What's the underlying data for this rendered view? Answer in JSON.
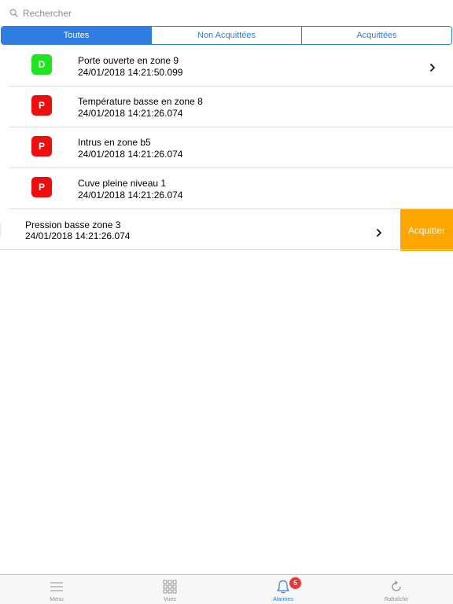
{
  "search": {
    "placeholder": "Rechercher"
  },
  "segments": [
    {
      "label": "Toutes"
    },
    {
      "label": "Non Acquittées"
    },
    {
      "label": "Acquittées"
    }
  ],
  "alarms": [
    {
      "badge": "D",
      "color": "#1ee51e",
      "title": "Porte ouverte en zone 9",
      "date": "24/01/2018 14:21:50.099"
    },
    {
      "badge": "P",
      "color": "#f20d0d",
      "title": "Température basse en zone 8",
      "date": "24/01/2018 14:21:26.074"
    },
    {
      "badge": "P",
      "color": "#f20d0d",
      "title": "Intrus en zone b5",
      "date": "24/01/2018 14:21:26.074"
    },
    {
      "badge": "P",
      "color": "#f20d0d",
      "title": "Cuve pleine niveau 1",
      "date": "24/01/2018 14:21:26.074"
    },
    {
      "title": "Pression basse zone 3",
      "date": "24/01/2018 14:21:26.074",
      "action": "Acquitter",
      "action_color": "#ffa500"
    }
  ],
  "tabbar": {
    "items": [
      {
        "label": "Menu",
        "icon": "menu-icon"
      },
      {
        "label": "Vues",
        "icon": "grid-icon"
      },
      {
        "label": "Alarmes",
        "icon": "bell-icon",
        "badge": "5"
      },
      {
        "label": "Rafraîchir",
        "icon": "refresh-icon"
      }
    ]
  },
  "colors": {
    "accent": "#2f7de1",
    "ack": "#ffa500",
    "notif": "#e6383a"
  }
}
